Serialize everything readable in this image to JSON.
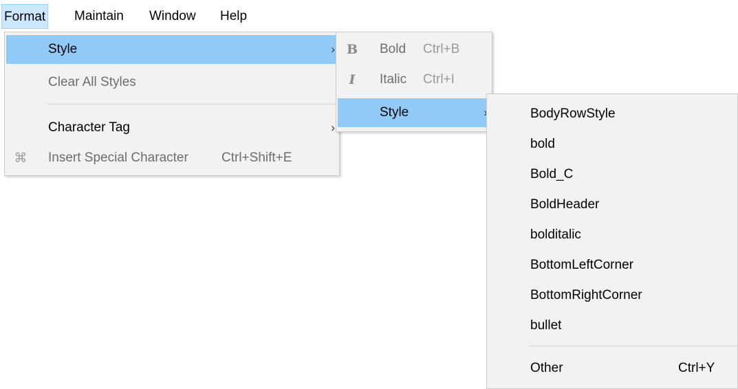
{
  "menubar": {
    "items": [
      {
        "label": "Format"
      },
      {
        "label": "Maintain"
      },
      {
        "label": "Window"
      },
      {
        "label": "Help"
      }
    ]
  },
  "format_menu": {
    "style": {
      "label": "Style",
      "arrow": "›"
    },
    "clear_all_styles": {
      "label": "Clear All Styles"
    },
    "character_tag": {
      "label": "Character Tag",
      "arrow": "›"
    },
    "insert_special_character": {
      "label": "Insert Special Character",
      "shortcut": "Ctrl+Shift+E",
      "icon": "special-character-icon",
      "glyph": "⌘"
    }
  },
  "style_submenu": {
    "bold": {
      "label": "Bold",
      "shortcut": "Ctrl+B",
      "icon": "bold-icon",
      "glyph": "B"
    },
    "italic": {
      "label": "Italic",
      "shortcut": "Ctrl+I",
      "icon": "italic-icon",
      "glyph": "I"
    },
    "style": {
      "label": "Style",
      "arrow": "›"
    }
  },
  "styles_list": {
    "items": [
      "BodyRowStyle",
      "bold",
      "Bold_C",
      "BoldHeader",
      "bolditalic",
      "BottomLeftCorner",
      "BottomRightCorner",
      "bullet"
    ],
    "other": {
      "label": "Other",
      "shortcut": "Ctrl+Y"
    }
  },
  "colors": {
    "highlight": "#91c9f7",
    "menu_bg": "#f2f2f2",
    "menubar_open": "#cce8ff",
    "disabled_text": "#6d6d6d"
  }
}
